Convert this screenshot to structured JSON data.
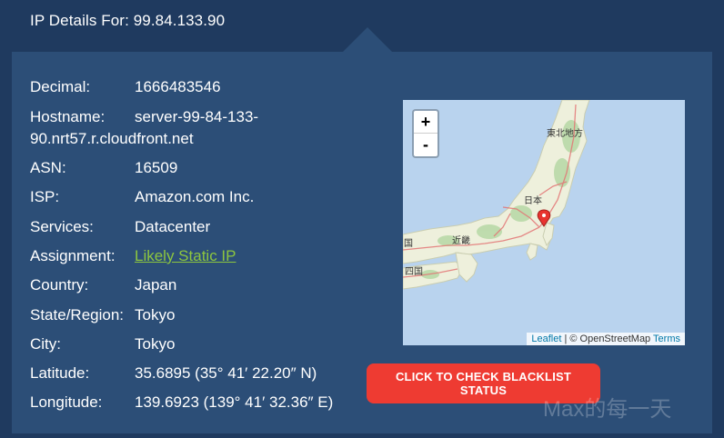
{
  "header": {
    "title": "IP Details For: 99.84.133.90"
  },
  "details": [
    {
      "label": "Decimal:",
      "value": "1666483546"
    },
    {
      "label": "Hostname:",
      "value": "server-99-84-133-",
      "value_line2": "90.nrt57.r.cloudfront.net"
    },
    {
      "label": "ASN:",
      "value": "16509"
    },
    {
      "label": "ISP:",
      "value": "Amazon.com Inc."
    },
    {
      "label": "Services:",
      "value": "Datacenter"
    },
    {
      "label": "Assignment:",
      "value": "Likely Static IP"
    },
    {
      "label": "Country:",
      "value": "Japan"
    },
    {
      "label": "State/Region:",
      "value": "Tokyo"
    },
    {
      "label": "City:",
      "value": "Tokyo"
    },
    {
      "label": "Latitude:",
      "value": "35.6895 (35° 41′ 22.20″ N)"
    },
    {
      "label": "Longitude:",
      "value": "139.6923 (139° 41′ 32.36″ E)"
    }
  ],
  "map": {
    "zoom_in": "+",
    "zoom_out": "-",
    "labels": {
      "tohoku": "東北地方",
      "japan": "日本",
      "kinki": "近畿",
      "chugoku": "国",
      "shikoku": "四国"
    },
    "attribution": {
      "leaflet": "Leaflet",
      "sep": " | © OpenStreetMap ",
      "terms": "Terms"
    }
  },
  "blacklist_button": "CLICK TO CHECK BLACKLIST STATUS",
  "watermark": "Max的每一天",
  "colors": {
    "page_bg": "#1f3a5f",
    "panel_bg": "#2c4e77",
    "link": "#8dc63f",
    "button": "#ee3b32",
    "sea": "#b9d3ee",
    "land": "#eef0dc"
  }
}
